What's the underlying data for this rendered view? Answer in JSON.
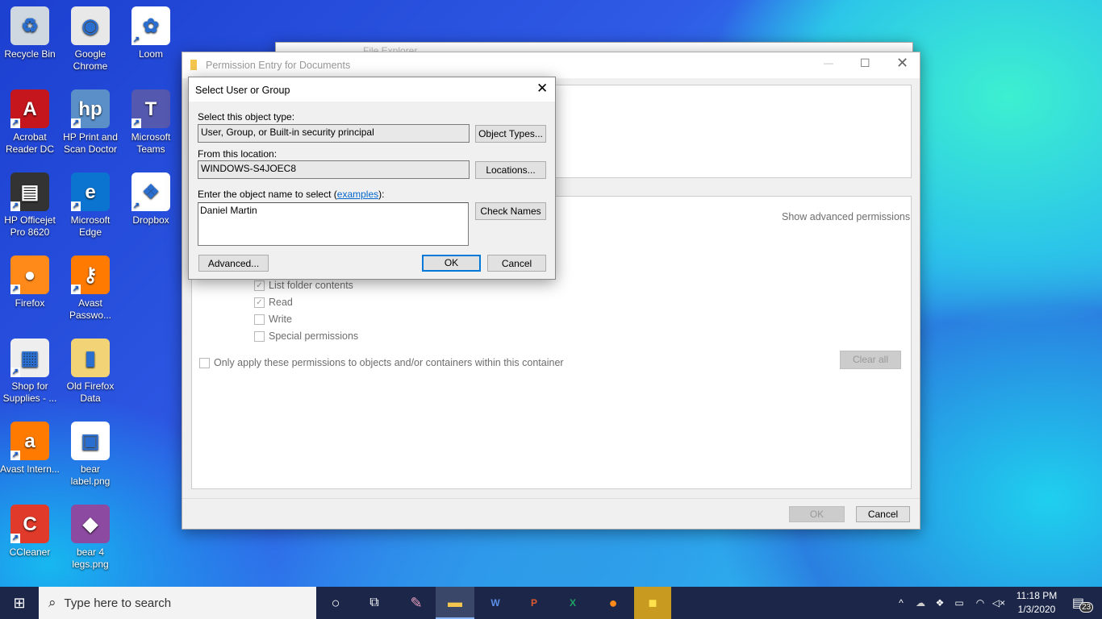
{
  "desktop": {
    "icons": [
      {
        "label": "Recycle Bin",
        "glyph": "♻",
        "color": "#cfd8e0"
      },
      {
        "label": "Google Chrome",
        "glyph": "◉",
        "color": "#e8e8e8"
      },
      {
        "label": "Loom",
        "glyph": "✿",
        "color": "#ffffff"
      },
      {
        "label": "Acrobat Reader DC",
        "glyph": "A",
        "color": "#c4161c"
      },
      {
        "label": "HP Print and Scan Doctor",
        "glyph": "hp",
        "color": "#5a8fc8"
      },
      {
        "label": "Microsoft Teams",
        "glyph": "T",
        "color": "#5558af"
      },
      {
        "label": "HP Officejet Pro 8620",
        "glyph": "▤",
        "color": "#333"
      },
      {
        "label": "Microsoft Edge",
        "glyph": "e",
        "color": "#0b74d0"
      },
      {
        "label": "Dropbox",
        "glyph": "❖",
        "color": "#ffffff"
      },
      {
        "label": "Firefox",
        "glyph": "●",
        "color": "#ff8a1a"
      },
      {
        "label": "Avast Passwo...",
        "glyph": "⚷",
        "color": "#ff7a00"
      },
      {
        "label": "Shop for Supplies - ...",
        "glyph": "▦",
        "color": "#eee"
      },
      {
        "label": "Old Firefox Data",
        "glyph": "▮",
        "color": "#f2d477"
      },
      {
        "label": "Avast Intern...",
        "glyph": "a",
        "color": "#ff7a00"
      },
      {
        "label": "bear label.png",
        "glyph": "▣",
        "color": "#ffffff"
      },
      {
        "label": "CCleaner",
        "glyph": "C",
        "color": "#e03a2a"
      },
      {
        "label": "bear 4 legs.png",
        "glyph": "◆",
        "color": "#8c4aa0"
      }
    ]
  },
  "explorer_title": "File Explorer",
  "permission": {
    "title": "Permission Entry for Documents",
    "show_advanced": "Show advanced permissions",
    "checks": [
      {
        "label": "List folder contents",
        "checked": true
      },
      {
        "label": "Read",
        "checked": true
      },
      {
        "label": "Write",
        "checked": false
      },
      {
        "label": "Special permissions",
        "checked": false
      }
    ],
    "only_apply": "Only apply these permissions to objects and/or containers within this container",
    "clear_all": "Clear all",
    "ok": "OK",
    "cancel": "Cancel"
  },
  "select": {
    "title": "Select User or Group",
    "type_label": "Select this object type:",
    "type_value": "User, Group, or Built-in security principal",
    "object_types": "Object Types...",
    "location_label": "From this location:",
    "location_value": "WINDOWS-S4JOEC8",
    "locations": "Locations...",
    "name_label_pre": "Enter the object name to select (",
    "name_label_link": "examples",
    "name_label_post": "):",
    "name_value": "Daniel Martin",
    "check_names": "Check Names",
    "advanced": "Advanced...",
    "ok": "OK",
    "cancel": "Cancel"
  },
  "taskbar": {
    "search_placeholder": "Type here to search",
    "time": "11:18 PM",
    "date": "1/3/2020",
    "notifications": "23"
  }
}
